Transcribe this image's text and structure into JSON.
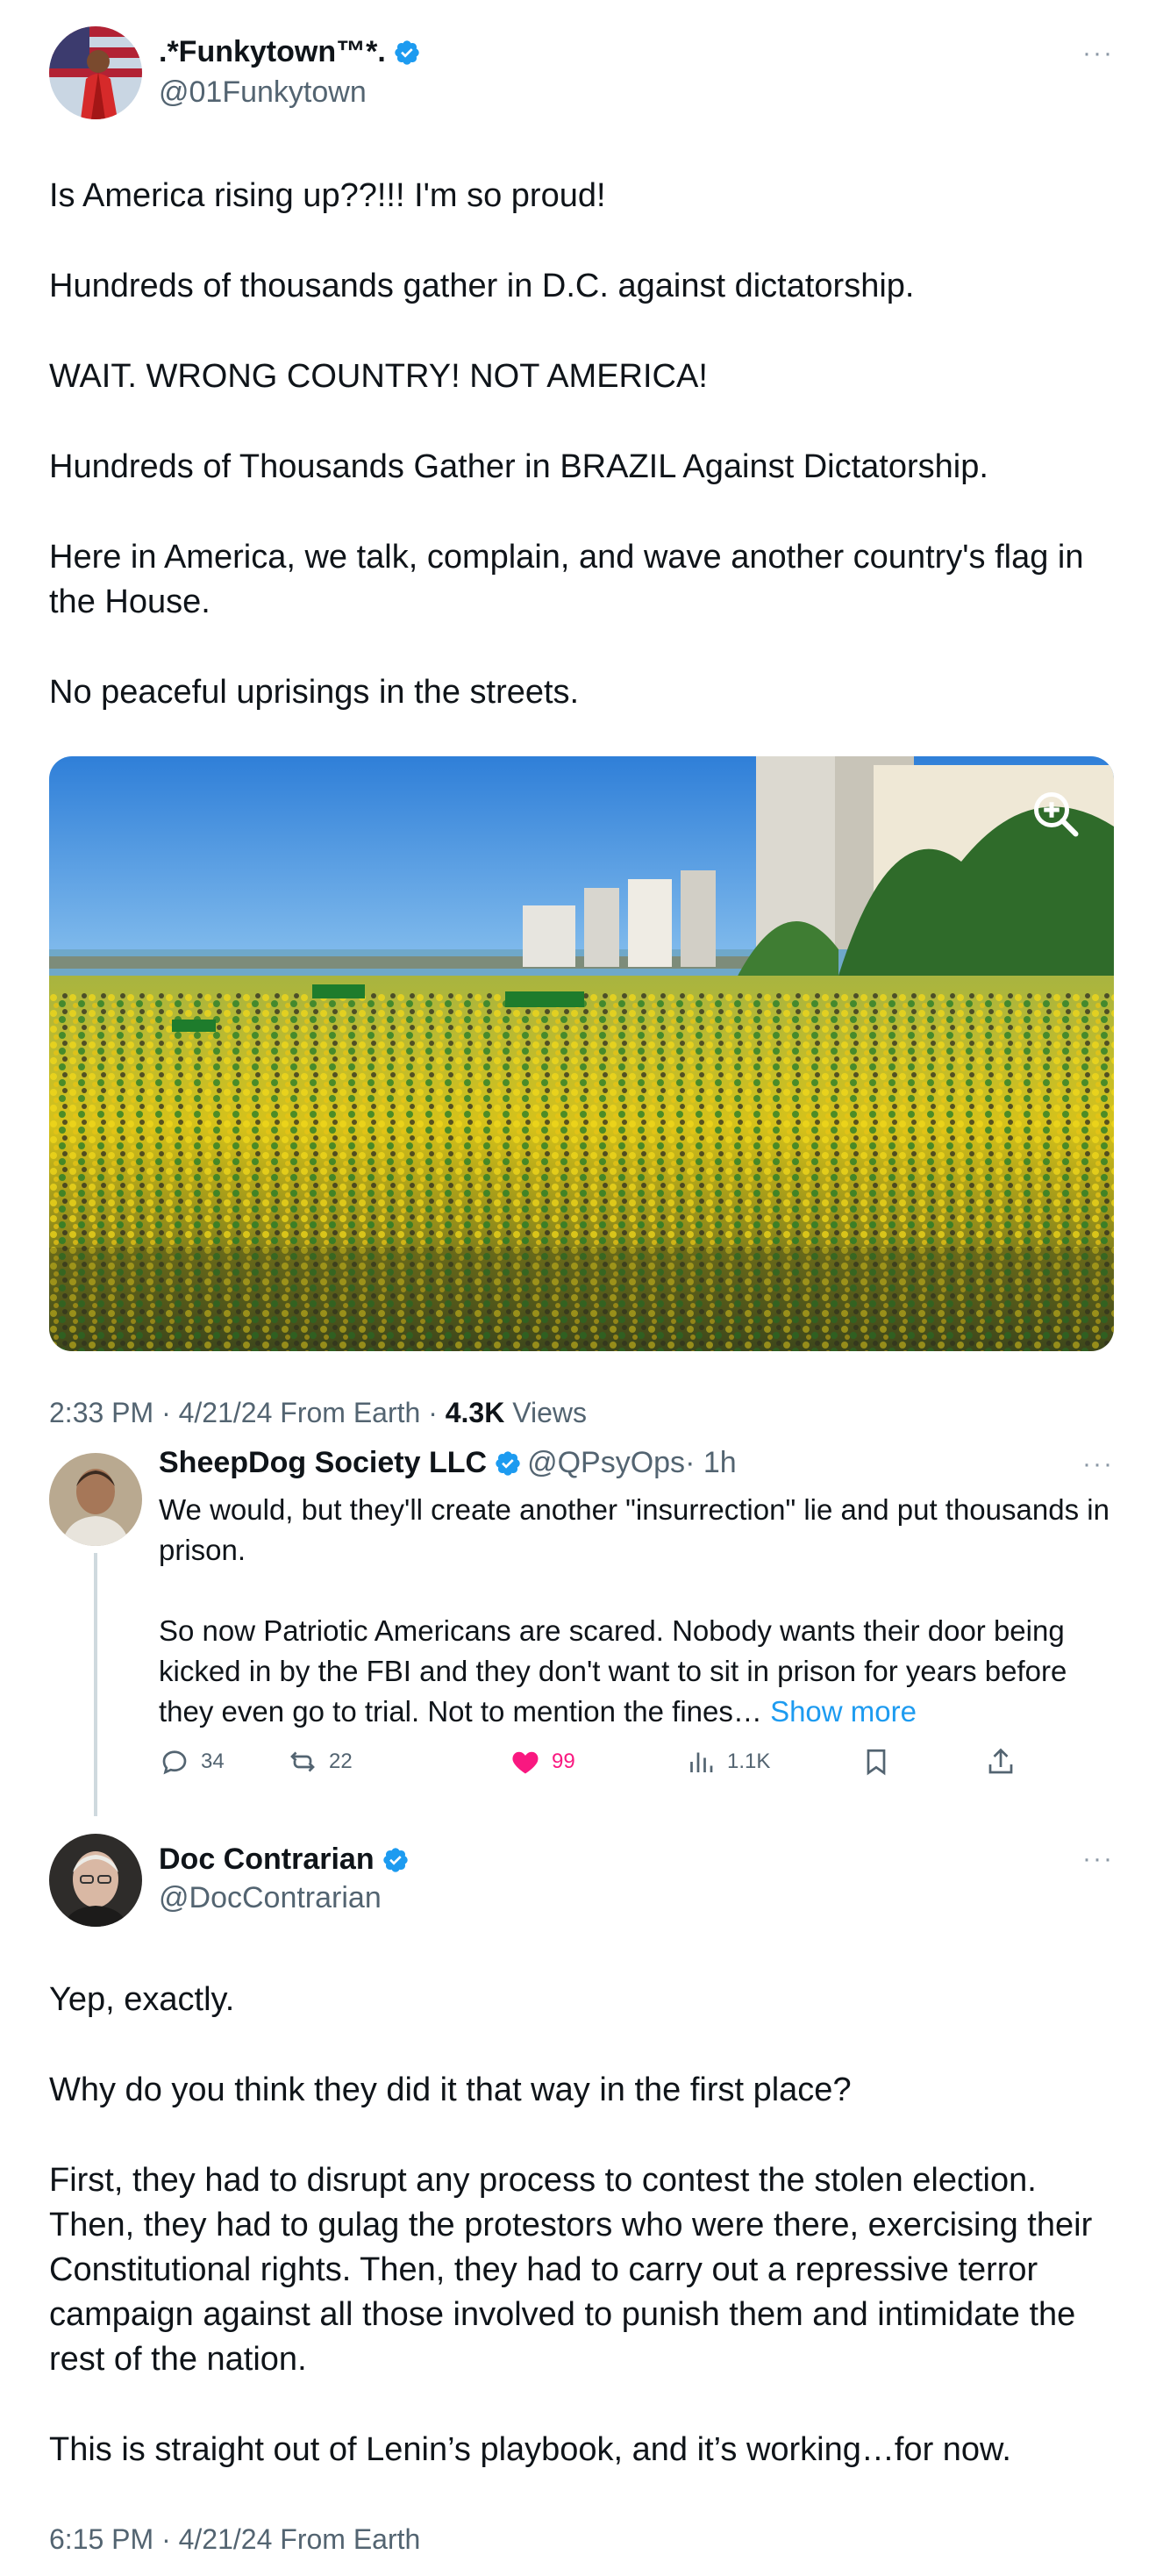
{
  "main_post": {
    "display_name": ".*Funkytown™*.",
    "handle": "@01Funkytown",
    "paragraphs": [
      "Is America rising up??!!! I'm so proud!",
      "Hundreds of thousands gather in D.C. against dictatorship.",
      "WAIT. WRONG COUNTRY! NOT AMERICA!",
      "Hundreds of Thousands Gather in BRAZIL Against Dictatorship.",
      "Here in America, we talk, complain, and wave another country's flag in the House.",
      "No peaceful uprisings in the streets."
    ],
    "meta_time": "2:33 PM · 4/21/24 From Earth · ",
    "views_count": "4.3K",
    "views_label": " Views"
  },
  "reply": {
    "display_name": "SheepDog Society LLC",
    "handle": "@QPsyOps",
    "age": " · 1h",
    "paragraphs": [
      "We would, but they'll create another \"insurrection\" lie and put thousands in prison.",
      "So now Patriotic Americans are scared. Nobody wants their door being kicked in by the FBI and they don't want to sit in prison for years before they even go to trial. Not to mention the fines…"
    ],
    "show_more": "Show more",
    "stats": {
      "replies": "34",
      "reposts": "22",
      "likes": "99",
      "views": "1.1K"
    }
  },
  "quote_post": {
    "display_name": "Doc Contrarian",
    "handle": "@DocContrarian",
    "paragraphs": [
      "Yep, exactly.",
      "Why do you think they did it that way in the first place?",
      "First, they had to disrupt any process to contest the stolen election. Then, they had to gulag the protestors who were there, exercising their Constitutional rights. Then, they had to carry out a repressive terror campaign against all those involved to punish them and intimidate the rest of the nation.",
      "This is straight out of Lenin’s playbook, and it’s working…for now."
    ],
    "meta_time": "6:15 PM · 4/21/24 From Earth"
  },
  "icons": [
    "verified-badge-icon",
    "more-options-icon",
    "zoom-icon",
    "reply-icon",
    "repost-icon",
    "like-icon",
    "views-icon",
    "bookmark-icon",
    "share-icon"
  ],
  "colors": {
    "text": "#0f1419",
    "secondary": "#536471",
    "link": "#1d9bf0",
    "verified": "#1d9bf0",
    "like": "#f91880",
    "thread_line": "#cfd9de"
  }
}
